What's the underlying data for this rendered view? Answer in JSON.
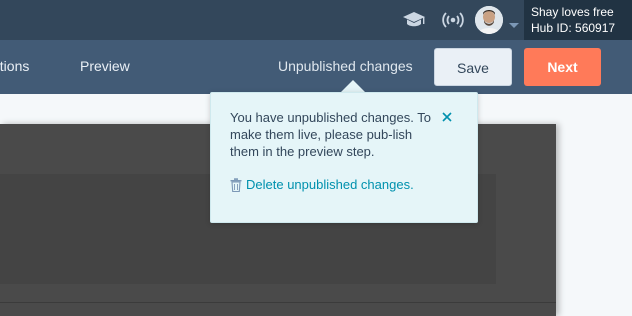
{
  "account": {
    "name": "Shay loves free",
    "hub_id": "Hub ID: 560917"
  },
  "nav": {
    "tabs": [
      "otions",
      "Preview"
    ],
    "unpublished_label": "Unpublished changes",
    "save_label": "Save",
    "next_label": "Next"
  },
  "popover": {
    "message": "You have unpublished changes. To make them live, please pub-lish them in the preview step.",
    "delete_label": "Delete unpublished changes."
  },
  "colors": {
    "topbar": "#33475b",
    "navbar": "#425b76",
    "next_button": "#ff7a59",
    "link": "#0091ae",
    "popover_bg": "#e5f5f8"
  },
  "icons": [
    "graduation-cap-icon",
    "broadcast-icon",
    "avatar",
    "chevron-down-icon",
    "close-icon",
    "trash-icon"
  ]
}
